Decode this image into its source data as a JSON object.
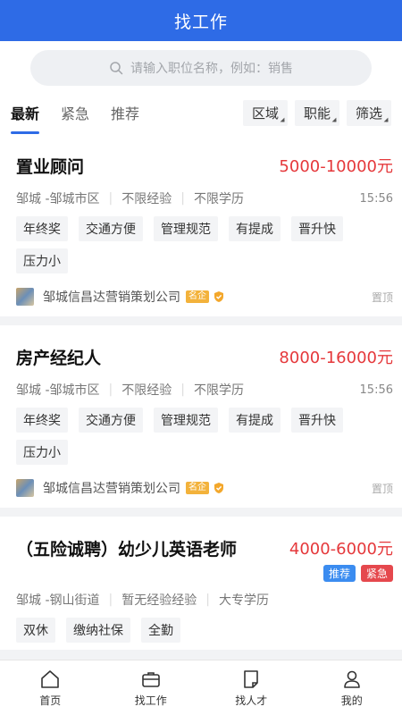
{
  "header": {
    "title": "找工作"
  },
  "search": {
    "placeholder": "请输入职位名称，例如：销售"
  },
  "tabs": [
    {
      "label": "最新",
      "active": true
    },
    {
      "label": "紧急",
      "active": false
    },
    {
      "label": "推荐",
      "active": false
    }
  ],
  "filters": [
    "区域",
    "职能",
    "筛选"
  ],
  "jobs": [
    {
      "title": "置业顾问",
      "salary": "5000-10000元",
      "location": "邹城 -邹城市区",
      "experience": "不限经验",
      "education": "不限学历",
      "time": "15:56",
      "tags": [
        "年终奖",
        "交通方便",
        "管理规范",
        "有提成",
        "晋升快",
        "压力小"
      ],
      "company": "邹城信昌达营销策划公司",
      "company_badge": "名企",
      "pin": "置顶"
    },
    {
      "title": "房产经纪人",
      "salary": "8000-16000元",
      "location": "邹城 -邹城市区",
      "experience": "不限经验",
      "education": "不限学历",
      "time": "15:56",
      "tags": [
        "年终奖",
        "交通方便",
        "管理规范",
        "有提成",
        "晋升快",
        "压力小"
      ],
      "company": "邹城信昌达营销策划公司",
      "company_badge": "名企",
      "pin": "置顶"
    },
    {
      "title": "（五险诚聘）幼少儿英语老师",
      "salary": "4000-6000元",
      "labels": [
        "推荐",
        "紧急"
      ],
      "location": "邹城 -钢山街道",
      "experience": "暂无经验经验",
      "education": "大专学历",
      "tags": [
        "双休",
        "缴纳社保",
        "全勤"
      ]
    }
  ],
  "bottom_nav": [
    {
      "label": "首页",
      "icon": "home-icon"
    },
    {
      "label": "找工作",
      "icon": "briefcase-icon"
    },
    {
      "label": "找人才",
      "icon": "document-icon"
    },
    {
      "label": "我的",
      "icon": "user-icon"
    }
  ],
  "colors": {
    "primary": "#2e6be6",
    "salary": "#e5383b",
    "recommend": "#3b8cf0",
    "urgent": "#e5484d"
  }
}
